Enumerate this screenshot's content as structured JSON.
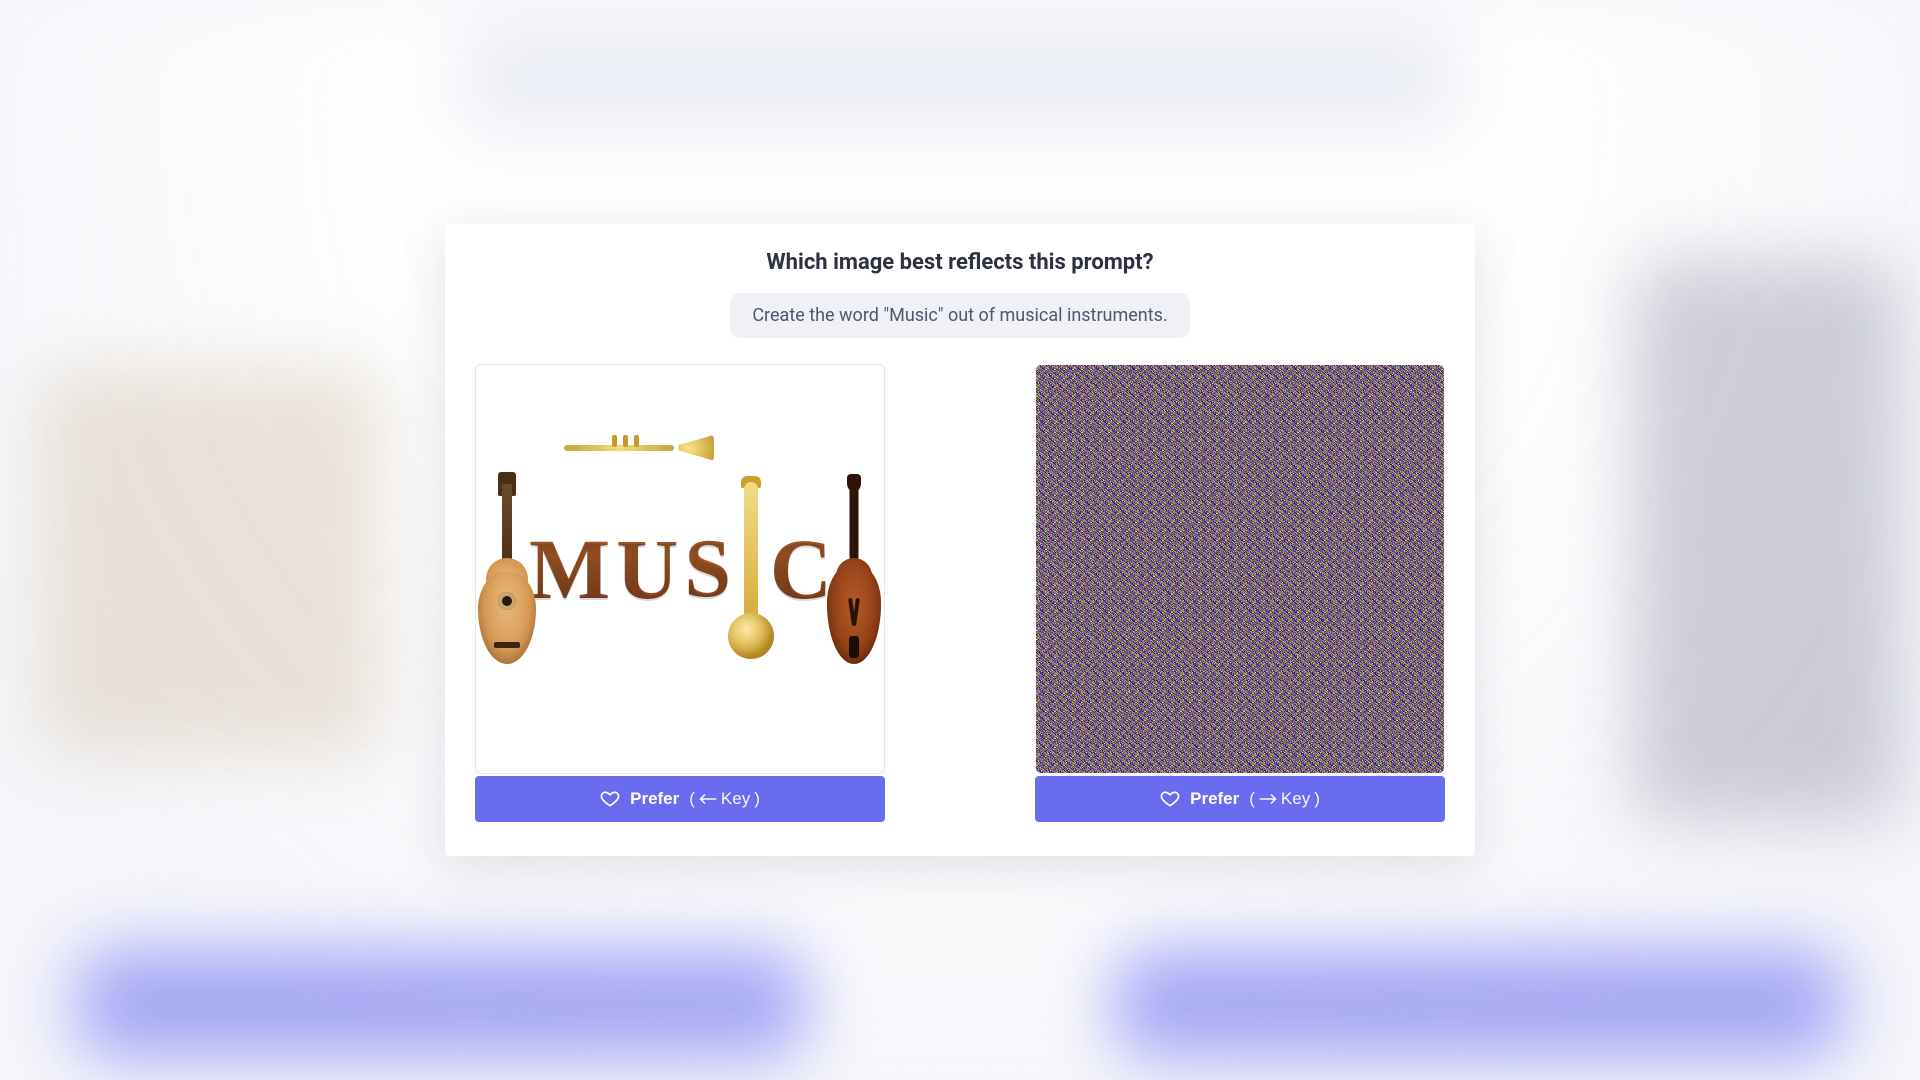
{
  "header": {
    "question": "Which image best reflects this prompt?"
  },
  "prompt": {
    "text": "Create the word \"Music\" out of musical instruments."
  },
  "options": {
    "left": {
      "description": "music-word-instruments",
      "prefer_label": "Prefer",
      "key_hint_open": "(",
      "key_hint_word": "Key",
      "key_hint_close": ")",
      "full_hint": "(← Key)"
    },
    "right": {
      "description": "color-noise",
      "prefer_label": "Prefer",
      "key_hint_open": "(",
      "key_hint_word": "Key",
      "key_hint_close": ")",
      "full_hint": "(→ Key)"
    }
  },
  "icons": {
    "heart": "heart-icon",
    "arrow_left": "arrow-left-icon",
    "arrow_right": "arrow-right-icon"
  },
  "colors": {
    "accent": "#6a6cf0",
    "text": "#2e3142",
    "pill_bg": "#f0f1f6"
  }
}
